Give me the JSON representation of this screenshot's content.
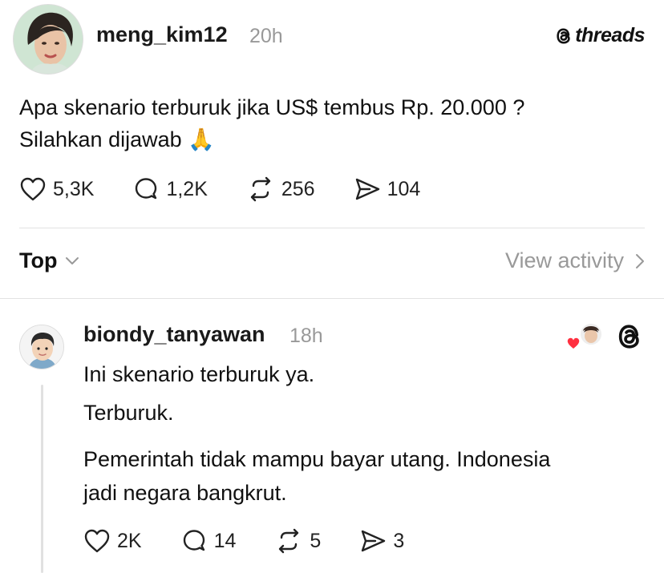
{
  "post": {
    "username": "meng_kim12",
    "time": "20h",
    "brand": "threads",
    "text_line1": "Apa skenario terburuk jika US$ tembus Rp. 20.000 ?",
    "text_line2": "Silahkan dijawab",
    "emoji": "🙏",
    "likes": "5,3K",
    "replies": "1,2K",
    "reposts": "256",
    "shares": "104"
  },
  "sort": {
    "label": "Top",
    "view_activity": "View activity"
  },
  "reply": {
    "username": "biondy_tanyawan",
    "time": "18h",
    "line1": "Ini skenario terburuk ya.",
    "line2": "Terburuk.",
    "line3": "Pemerintah tidak mampu bayar utang. Indonesia",
    "line4": "jadi negara bangkrut.",
    "likes": "2K",
    "replies": "14",
    "reposts": "5",
    "shares": "3"
  },
  "colors": {
    "text": "#111111",
    "muted": "#999999",
    "divider": "#e2e2e2",
    "heart": "#ff3040"
  },
  "icons": [
    "heart-icon",
    "comment-icon",
    "repost-icon",
    "share-icon",
    "chevron-down-icon",
    "chevron-right-icon",
    "threads-icon"
  ]
}
